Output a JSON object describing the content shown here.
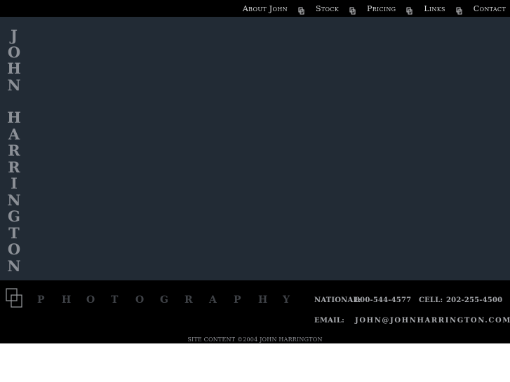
{
  "nav": {
    "items": [
      {
        "label": "About John"
      },
      {
        "label": "Stock"
      },
      {
        "label": "Pricing"
      },
      {
        "label": "Links"
      },
      {
        "label": "Contact"
      }
    ],
    "separator_icon": "overlapping-squares-icon"
  },
  "name_vertical": {
    "first": [
      "J",
      "O",
      "H",
      "N"
    ],
    "last": [
      "H",
      "A",
      "R",
      "R",
      "I",
      "N",
      "G",
      "T",
      "O",
      "N"
    ]
  },
  "footer": {
    "logo_icon": "overlapping-squares-logo-icon",
    "tagline_letters": [
      "P",
      "H",
      "O",
      "T",
      "O",
      "G",
      "R",
      "A",
      "P",
      "H",
      "Y"
    ],
    "national_label": "NATIONAL:",
    "national_value": "800-544-4577",
    "cell_label": "CELL:",
    "cell_value": "202-255-4500",
    "email_label": "EMAIL:",
    "email_value": "JOHN@JOHNHARRINGTON.COM",
    "copyright": "SITE CONTENT ©2004 JOHN HARRINGTON"
  },
  "colors": {
    "topbar": "#000000",
    "main": "#222b35",
    "footer": "#000000",
    "name_text": "#8c9097",
    "nav_text": "#d8dadb"
  }
}
